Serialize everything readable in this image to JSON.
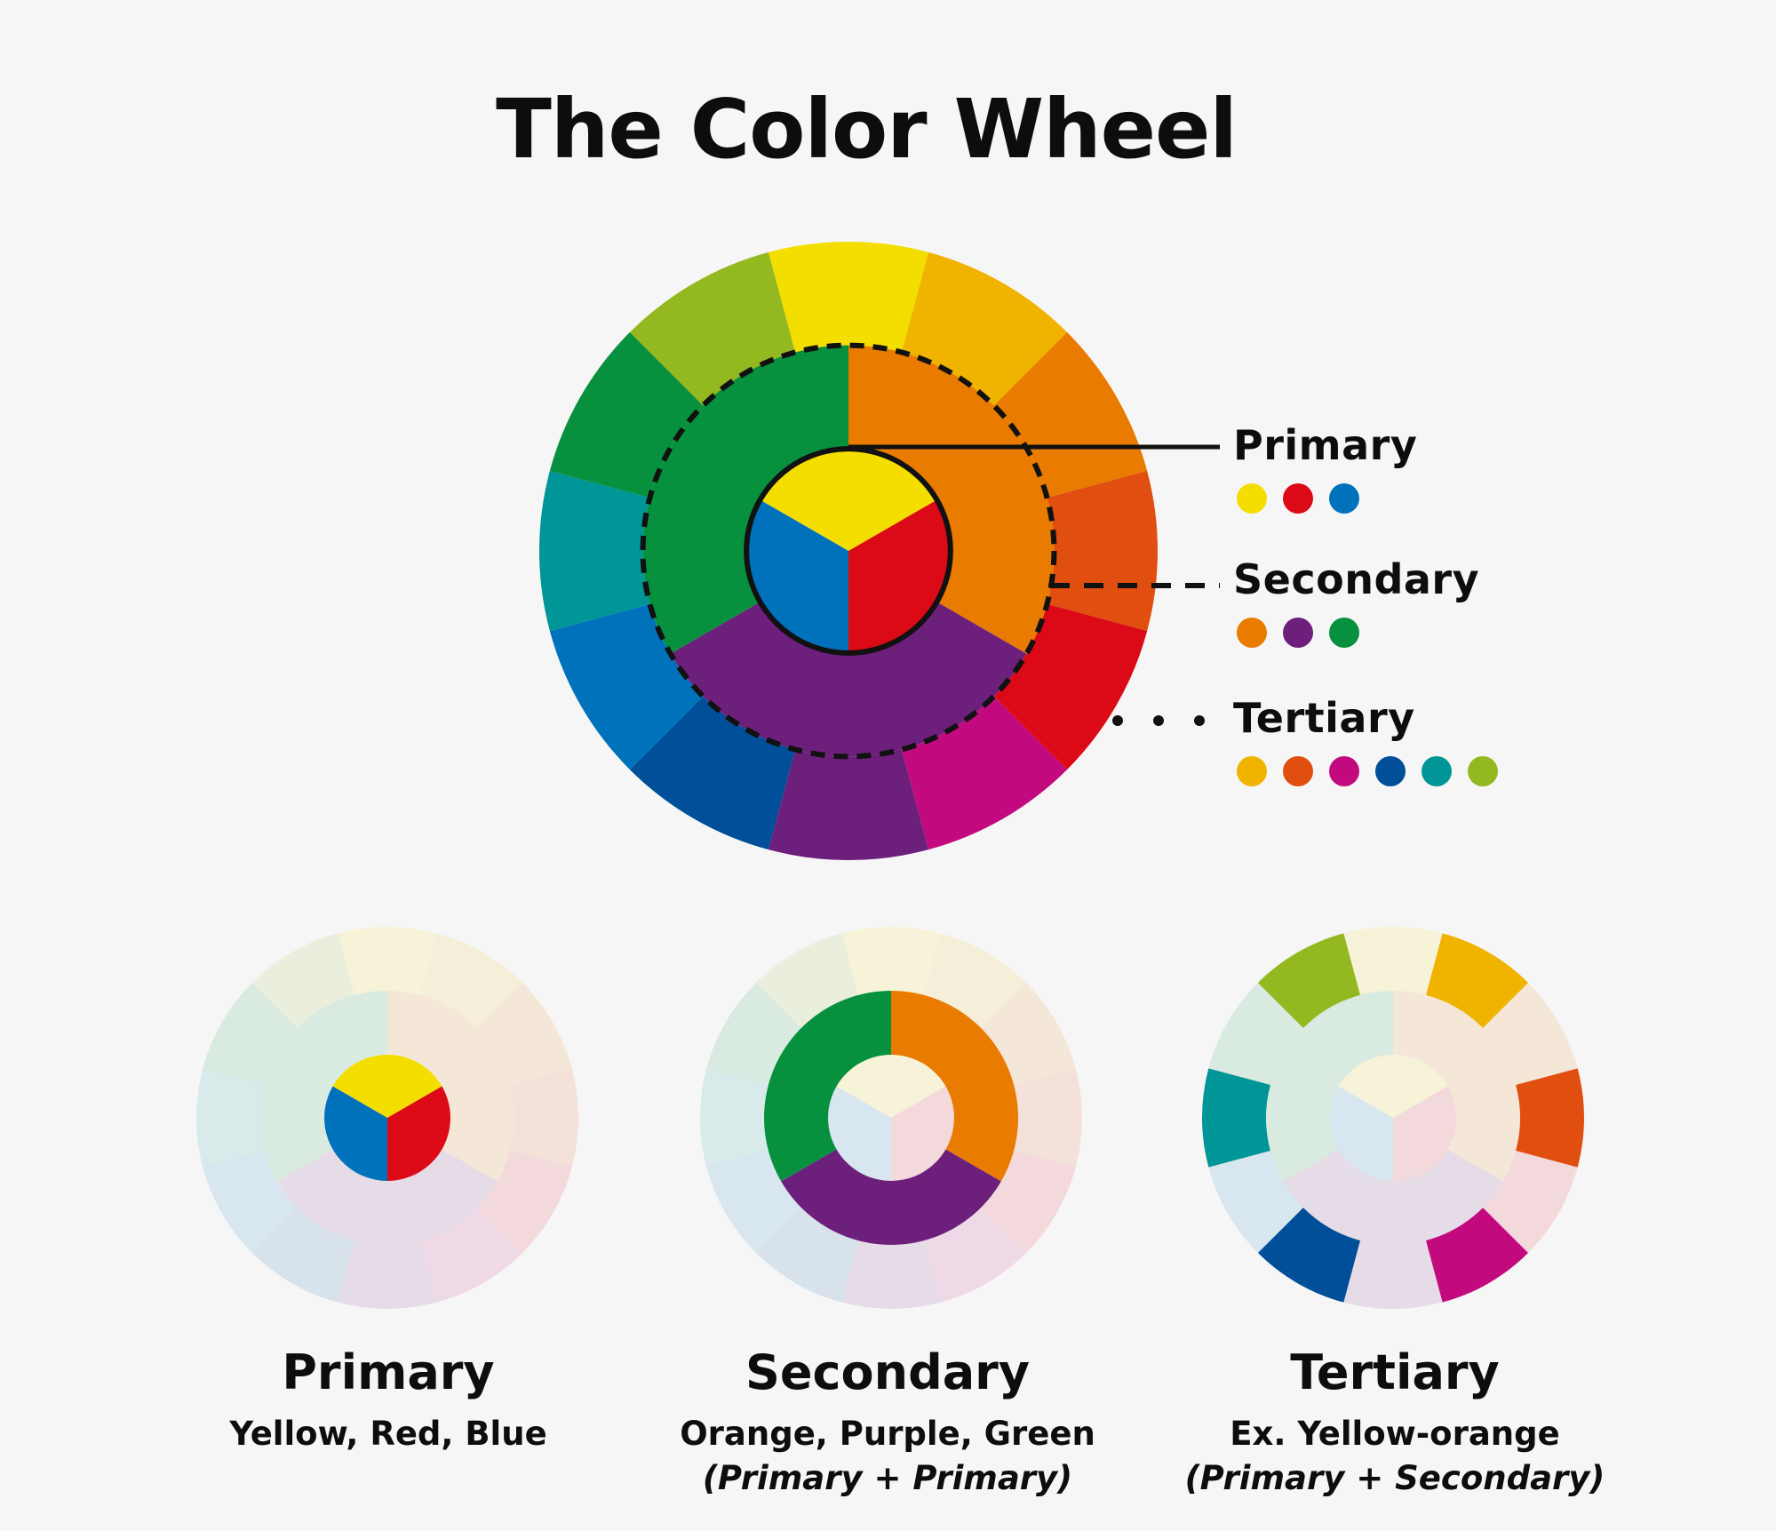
{
  "title": "The Color Wheel",
  "colors": {
    "yellow": "#f3de00",
    "yellow_orange": "#f0b400",
    "orange": "#e97b00",
    "red_orange": "#e04e10",
    "red": "#dc0a16",
    "red_purple": "#c20a7e",
    "purple": "#6c1f7b",
    "blue_purple": "#004f98",
    "blue": "#0072bb",
    "blue_green": "#009596",
    "green": "#07913f",
    "yellow_green": "#94b81f"
  },
  "legend": {
    "primary": {
      "label": "Primary",
      "swatches": [
        "yellow",
        "red",
        "blue"
      ]
    },
    "secondary": {
      "label": "Secondary",
      "swatches": [
        "orange",
        "purple",
        "green"
      ]
    },
    "tertiary": {
      "label": "Tertiary",
      "swatches": [
        "yellow_orange",
        "red_orange",
        "red_purple",
        "blue_purple",
        "blue_green",
        "yellow_green"
      ]
    }
  },
  "captions": {
    "primary": {
      "title": "Primary",
      "desc": "Yellow, Red, Blue",
      "note": ""
    },
    "secondary": {
      "title": "Secondary",
      "desc": "Orange, Purple, Green",
      "note": "(Primary + Primary)"
    },
    "tertiary": {
      "title": "Tertiary",
      "desc": "Ex. Yellow-orange",
      "note": "(Primary + Secondary)"
    }
  }
}
